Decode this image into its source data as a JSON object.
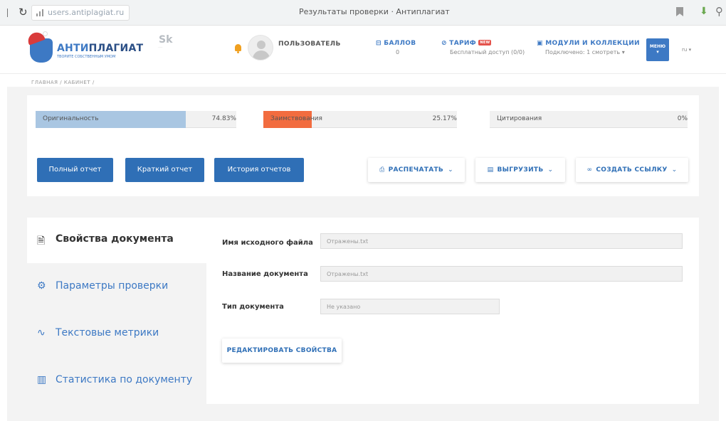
{
  "browser": {
    "url": "users.antiplagiat.ru",
    "page_title": "Результаты проверки · Антиплагиат"
  },
  "header": {
    "logo_part1": "АНТИ",
    "logo_part2": "ПЛАГИАТ",
    "logo_tagline": "ТВОРИТЕ СОБСТВЕННЫМ УМОМ",
    "sk_logo": "Sk",
    "user_label": "ПОЛЬЗОВАТЕЛЬ",
    "points_label": "БАЛЛОВ",
    "points_value": "0",
    "tariff_label": "ТАРИФ",
    "tariff_badge": "NEW",
    "tariff_value": "Бесплатный доступ (0/0)",
    "modules_label": "МОДУЛИ И КОЛЛЕКЦИИ",
    "modules_value": "Подключено: 1 смотреть",
    "menu_label": "МЕНЮ",
    "lang": "ru"
  },
  "breadcrumb": "ГЛАВНАЯ / КАБИНЕТ /",
  "metrics": [
    {
      "label": "Оригинальность",
      "value": "74.83%",
      "fraction": 0.7483,
      "color": "#a9c6e2"
    },
    {
      "label": "Заимствования",
      "value": "25.17%",
      "fraction": 0.2517,
      "color": "#f26c3f"
    },
    {
      "label": "Цитирования",
      "value": "0%",
      "fraction": 0,
      "color": "#a9c6e2"
    }
  ],
  "buttons": {
    "full_report": "Полный отчет",
    "short_report": "Краткий отчет",
    "history": "История отчетов",
    "print": "РАСПЕЧАТАТЬ",
    "export": "ВЫГРУЗИТЬ",
    "link": "СОЗДАТЬ ССЫЛКУ"
  },
  "side_tabs": [
    {
      "label": "Свойства документа",
      "icon": "document-icon",
      "active": true
    },
    {
      "label": "Параметры проверки",
      "icon": "gear-icon",
      "active": false
    },
    {
      "label": "Текстовые метрики",
      "icon": "metrics-icon",
      "active": false
    },
    {
      "label": "Статистика по документу",
      "icon": "chart-icon",
      "active": false
    }
  ],
  "properties": {
    "filename_label": "Имя исходного файла",
    "filename_value": "Отражены.txt",
    "docname_label": "Название документа",
    "docname_value": "Отражены.txt",
    "doctype_label": "Тип документа",
    "doctype_value": "Не указано",
    "edit_button": "РЕДАКТИРОВАТЬ СВОЙСТВА"
  }
}
